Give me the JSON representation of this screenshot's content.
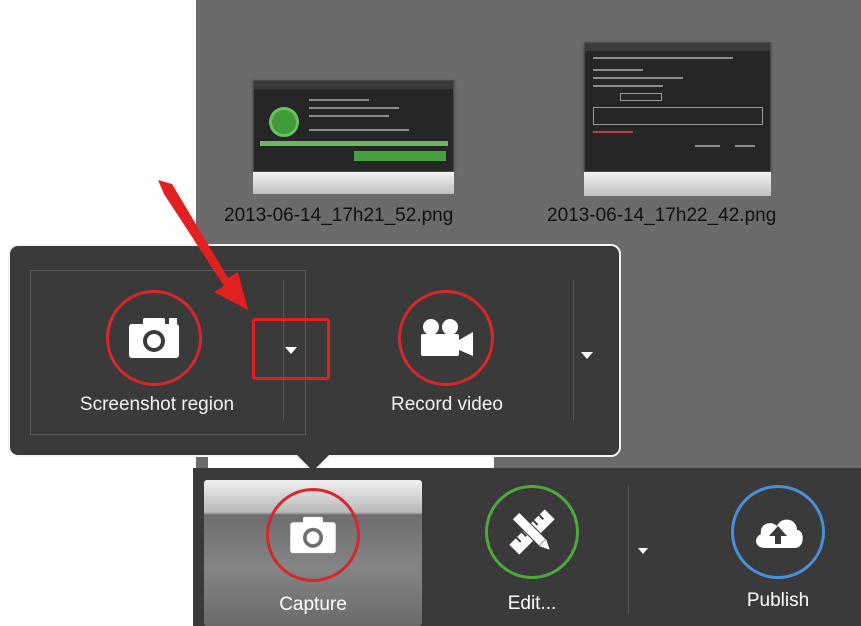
{
  "thumbnails": [
    {
      "filename": "2013-06-14_17h21_52.png"
    },
    {
      "filename": "2013-06-14_17h22_42.png"
    }
  ],
  "popup": {
    "screenshot_label": "Screenshot region",
    "record_label": "Record video"
  },
  "toolbar": {
    "capture_label": "Capture",
    "edit_label": "Edit...",
    "publish_label": "Publish"
  },
  "colors": {
    "red_ring": "#d9262a",
    "green_ring": "#4fa83c",
    "blue_ring": "#4a90d9",
    "annotation_red": "#e12020",
    "panel": "#3a3a3a"
  },
  "icons": [
    "camera-icon",
    "video-camera-icon",
    "edit-tools-icon",
    "cloud-upload-icon",
    "triangle-down-icon",
    "red-arrow-annotation"
  ]
}
